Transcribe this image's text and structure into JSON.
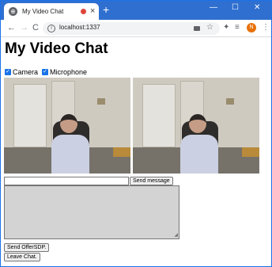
{
  "browser": {
    "tab_title": "My Video Chat",
    "url": "localhost:1337",
    "new_tab": "+",
    "close_tab": "×",
    "avatar_initial": "N",
    "nav": {
      "back": "←",
      "forward": "→",
      "reload": "C"
    },
    "window_controls": {
      "minimize": "—",
      "maximize": "☐",
      "close": "✕"
    },
    "accent_color": "#2f6fd0"
  },
  "page": {
    "title": "My Video Chat",
    "checkboxes": [
      {
        "label": "Camera",
        "checked": true
      },
      {
        "label": "Microphone",
        "checked": true
      }
    ],
    "message_input": {
      "value": ""
    },
    "send_message_label": "Send message",
    "log_textarea": {
      "value": ""
    },
    "send_offer_label": "Send OfferSDP.",
    "leave_chat_label": "Leave Chat."
  }
}
